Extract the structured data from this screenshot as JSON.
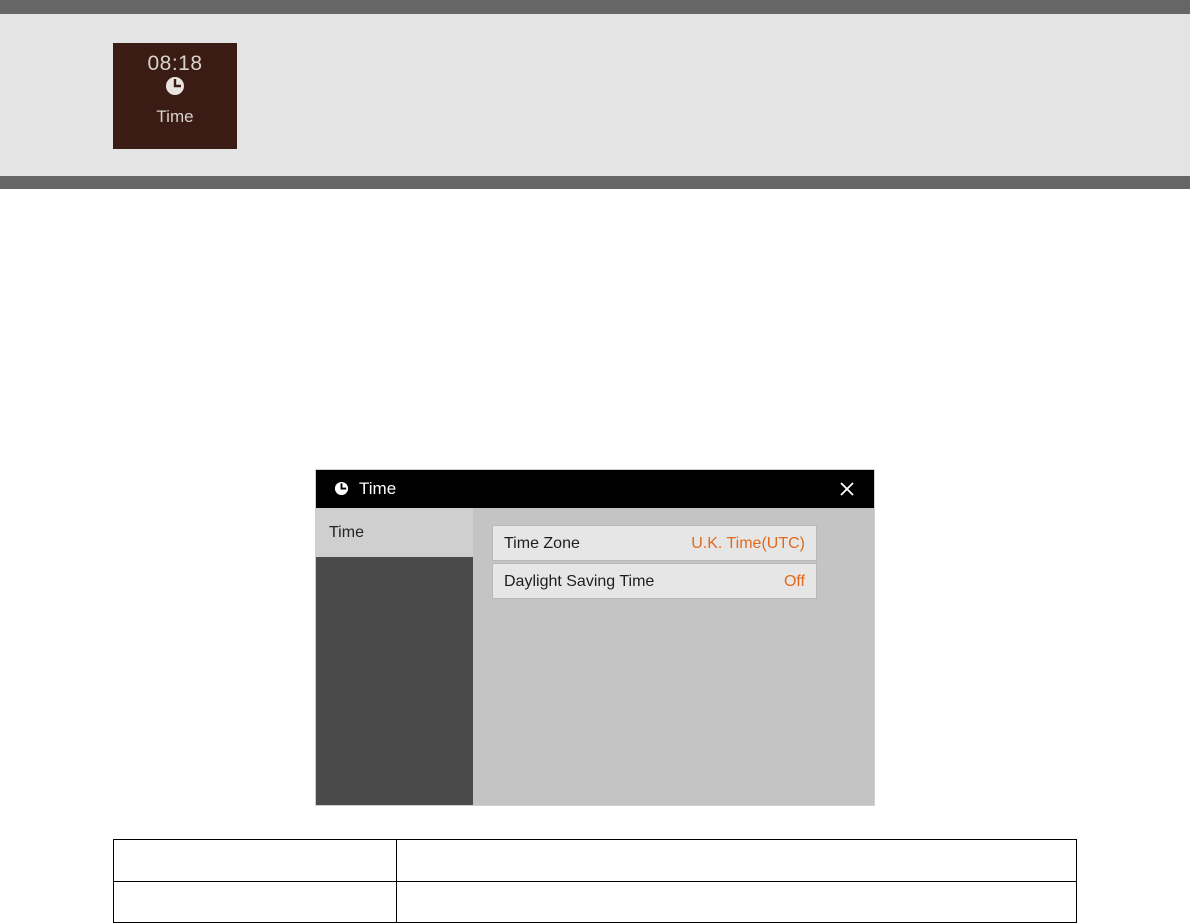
{
  "header": {
    "tile": {
      "clock_text": "08:18",
      "icon": "clock-icon",
      "label": "Time",
      "background": "#3a1c14"
    }
  },
  "dialog": {
    "title_icon": "clock-icon",
    "title": "Time",
    "close_icon": "close-icon",
    "sidebar": {
      "tabs": [
        {
          "label": "Time",
          "selected": true
        }
      ]
    },
    "settings": [
      {
        "label": "Time Zone",
        "value": "U.K. Time(UTC)"
      },
      {
        "label": "Daylight Saving Time",
        "value": "Off"
      }
    ],
    "value_color": "#e26a1e"
  },
  "table": {
    "rows": [
      [
        "",
        ""
      ],
      [
        "",
        ""
      ]
    ]
  }
}
